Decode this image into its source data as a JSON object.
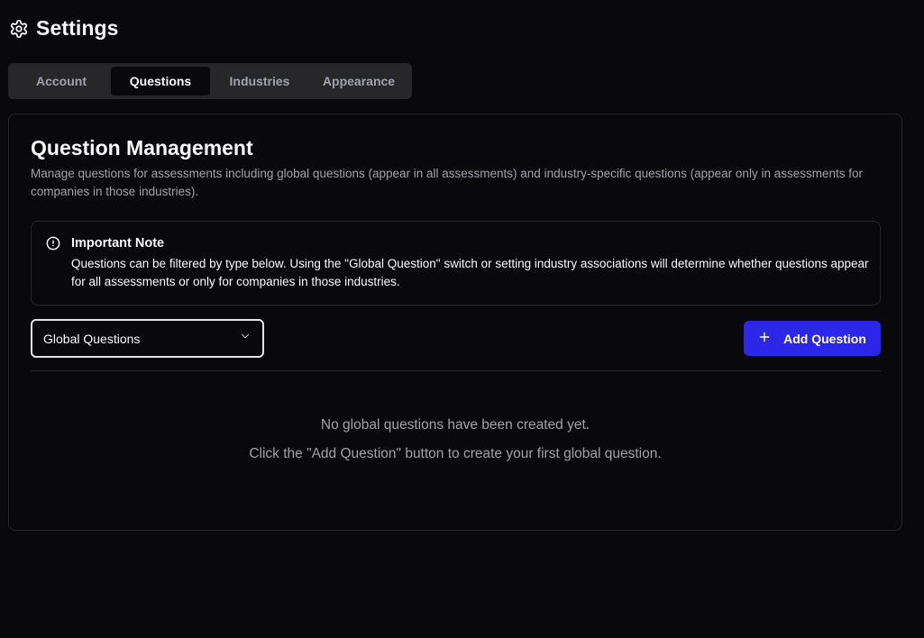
{
  "header": {
    "title": "Settings",
    "icon": "gear-icon"
  },
  "tabs": [
    {
      "label": "Account",
      "active": false
    },
    {
      "label": "Questions",
      "active": true
    },
    {
      "label": "Industries",
      "active": false
    },
    {
      "label": "Appearance",
      "active": false
    }
  ],
  "card": {
    "title": "Question Management",
    "description": "Manage questions for assessments including global questions (appear in all assessments) and industry-specific questions (appear only in assessments for companies in those industries)."
  },
  "alert": {
    "icon": "alert-circle-icon",
    "title": "Important Note",
    "body": "Questions can be filtered by type below. Using the \"Global Question\" switch or setting industry associations will determine whether questions appear for all assessments or only for companies in those industries."
  },
  "filter": {
    "selected": "Global Questions",
    "icon": "chevron-down-icon"
  },
  "add_button": {
    "label": "Add Question",
    "icon": "plus-icon"
  },
  "empty_state": {
    "title": "No global questions have been created yet.",
    "hint": "Click the \"Add Question\" button to create your first global question."
  },
  "colors": {
    "background": "#09090b",
    "accent": "#2b26e8",
    "muted_text": "#a1a1aa",
    "border": "#27272a"
  }
}
